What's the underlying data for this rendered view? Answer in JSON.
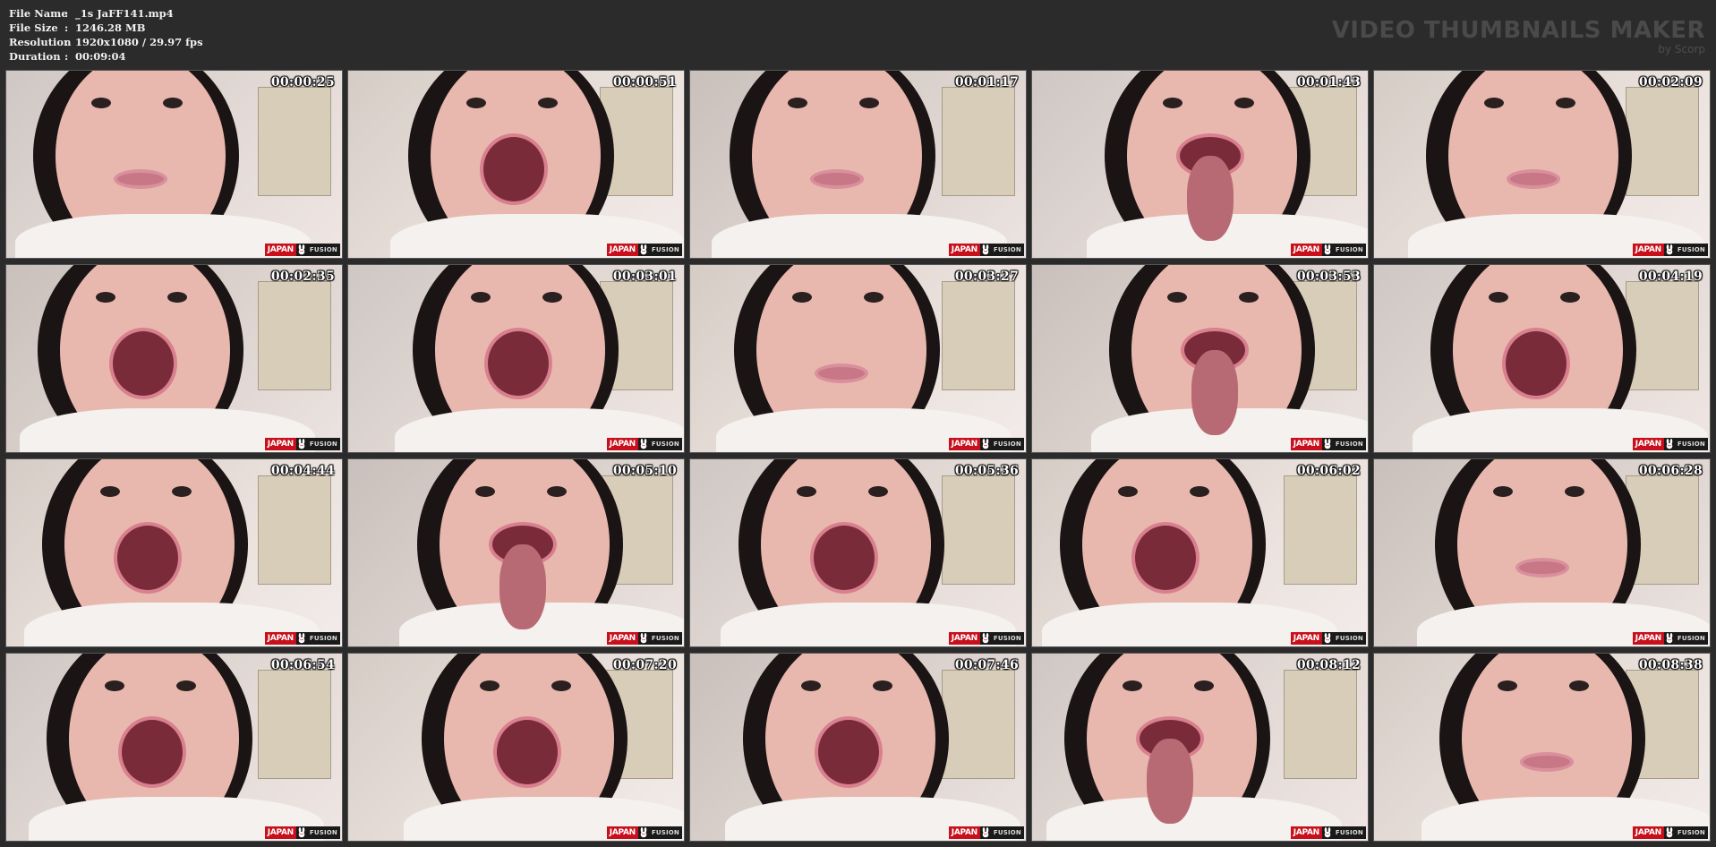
{
  "file_info": {
    "rows": [
      {
        "key": "File Name",
        "sep": ":",
        "value": "_1s JaFF141.mp4"
      },
      {
        "key": "File Size",
        "sep": ":",
        "value": "1246.28 MB"
      },
      {
        "key": "Resolution",
        "sep": ":",
        "value": "1920x1080 / 29.97 fps"
      },
      {
        "key": "Duration",
        "sep": ":",
        "value": "00:09:04"
      }
    ]
  },
  "brand": {
    "title": "VIDEO THUMBNAILS MAKER",
    "subtitle": "by Scorp"
  },
  "watermark": {
    "left": "JAPAN",
    "right": "FUSION"
  },
  "thumbnails": [
    {
      "timestamp": "00:00:25",
      "scene": "smile"
    },
    {
      "timestamp": "00:00:51",
      "scene": "open"
    },
    {
      "timestamp": "00:01:17",
      "scene": "smile"
    },
    {
      "timestamp": "00:01:43",
      "scene": "tongue"
    },
    {
      "timestamp": "00:02:09",
      "scene": "smile"
    },
    {
      "timestamp": "00:02:35",
      "scene": "open"
    },
    {
      "timestamp": "00:03:01",
      "scene": "open"
    },
    {
      "timestamp": "00:03:27",
      "scene": "smile"
    },
    {
      "timestamp": "00:03:53",
      "scene": "tongue"
    },
    {
      "timestamp": "00:04:19",
      "scene": "open"
    },
    {
      "timestamp": "00:04:44",
      "scene": "open"
    },
    {
      "timestamp": "00:05:10",
      "scene": "tongue"
    },
    {
      "timestamp": "00:05:36",
      "scene": "open"
    },
    {
      "timestamp": "00:06:02",
      "scene": "open"
    },
    {
      "timestamp": "00:06:28",
      "scene": "smile"
    },
    {
      "timestamp": "00:06:54",
      "scene": "open"
    },
    {
      "timestamp": "00:07:20",
      "scene": "open"
    },
    {
      "timestamp": "00:07:46",
      "scene": "open"
    },
    {
      "timestamp": "00:08:12",
      "scene": "tongue"
    },
    {
      "timestamp": "00:08:38",
      "scene": "smile"
    }
  ]
}
